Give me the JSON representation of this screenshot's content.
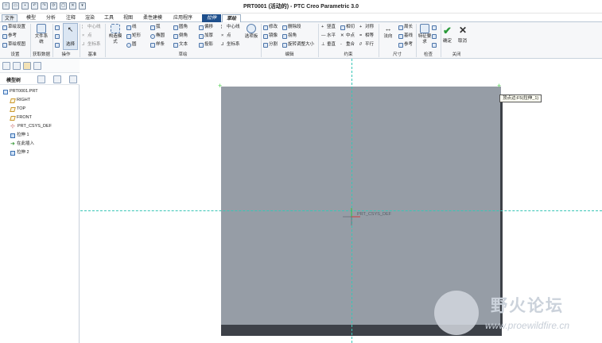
{
  "titlebar": {
    "title": "PRT0001 (活动的) - PTC Creo Parametric 3.0"
  },
  "menu": {
    "tabs": [
      "文件",
      "模型",
      "分析",
      "注释",
      "渲染",
      "工具",
      "视图",
      "柔性建模",
      "应用程序",
      "拉伸",
      "草绘"
    ]
  },
  "ribbon": {
    "setup": [
      "草绘设置",
      "参考",
      "草绘视图"
    ],
    "get_data": {
      "file": "文件系统"
    },
    "ops_select": "选择",
    "datum": [
      "中心线",
      "点",
      "坐标系"
    ],
    "palette_btn": "构造模式",
    "sketch_col1": [
      "线",
      "矩形",
      "圆"
    ],
    "sketch_col2": [
      "弧",
      "椭圆",
      "样条"
    ],
    "sketch_col3": [
      "圆角",
      "倒角",
      "文本"
    ],
    "sketch_col4": [
      "偏移",
      "加厚",
      "投影"
    ],
    "sketch_col5": [
      "中心线",
      "点",
      "坐标系"
    ],
    "palette": "选项板",
    "edit": [
      "修改",
      "删除段",
      "镜像",
      "拐角",
      "分割",
      "旋转调整大小"
    ],
    "constraint": [
      "竖直",
      "相切",
      "对称",
      "水平",
      "中点",
      "相等",
      "垂直",
      "重合",
      "平行"
    ],
    "dimension": [
      "法向",
      "周长",
      "基线",
      "参考"
    ],
    "inspect": "特征要求",
    "close": {
      "ok": "确定",
      "cancel": "取消"
    },
    "groups": [
      "设置",
      "获取数据",
      "操作",
      "基准",
      "草绘",
      "编辑",
      "约束",
      "尺寸",
      "检查",
      "关闭"
    ]
  },
  "tree": {
    "title": "模型树",
    "items": [
      "PRT0001.PRT",
      "RIGHT",
      "TOP",
      "FRONT",
      "PRT_CSYS_DEF",
      "拉伸 1",
      "在此插入",
      "拉伸 2"
    ]
  },
  "graphics": {
    "tooltip": "顶点边:F5(拉伸_1)",
    "csys_label": "PRT_CSYS_DEF"
  },
  "watermark": {
    "title": "野火论坛",
    "url": "www.proewildfire.cn"
  },
  "colors": {
    "accent": "#1e4f8c",
    "plane": "#969da6",
    "dash": "#38c6b6",
    "ok": "#2a9a3a"
  }
}
